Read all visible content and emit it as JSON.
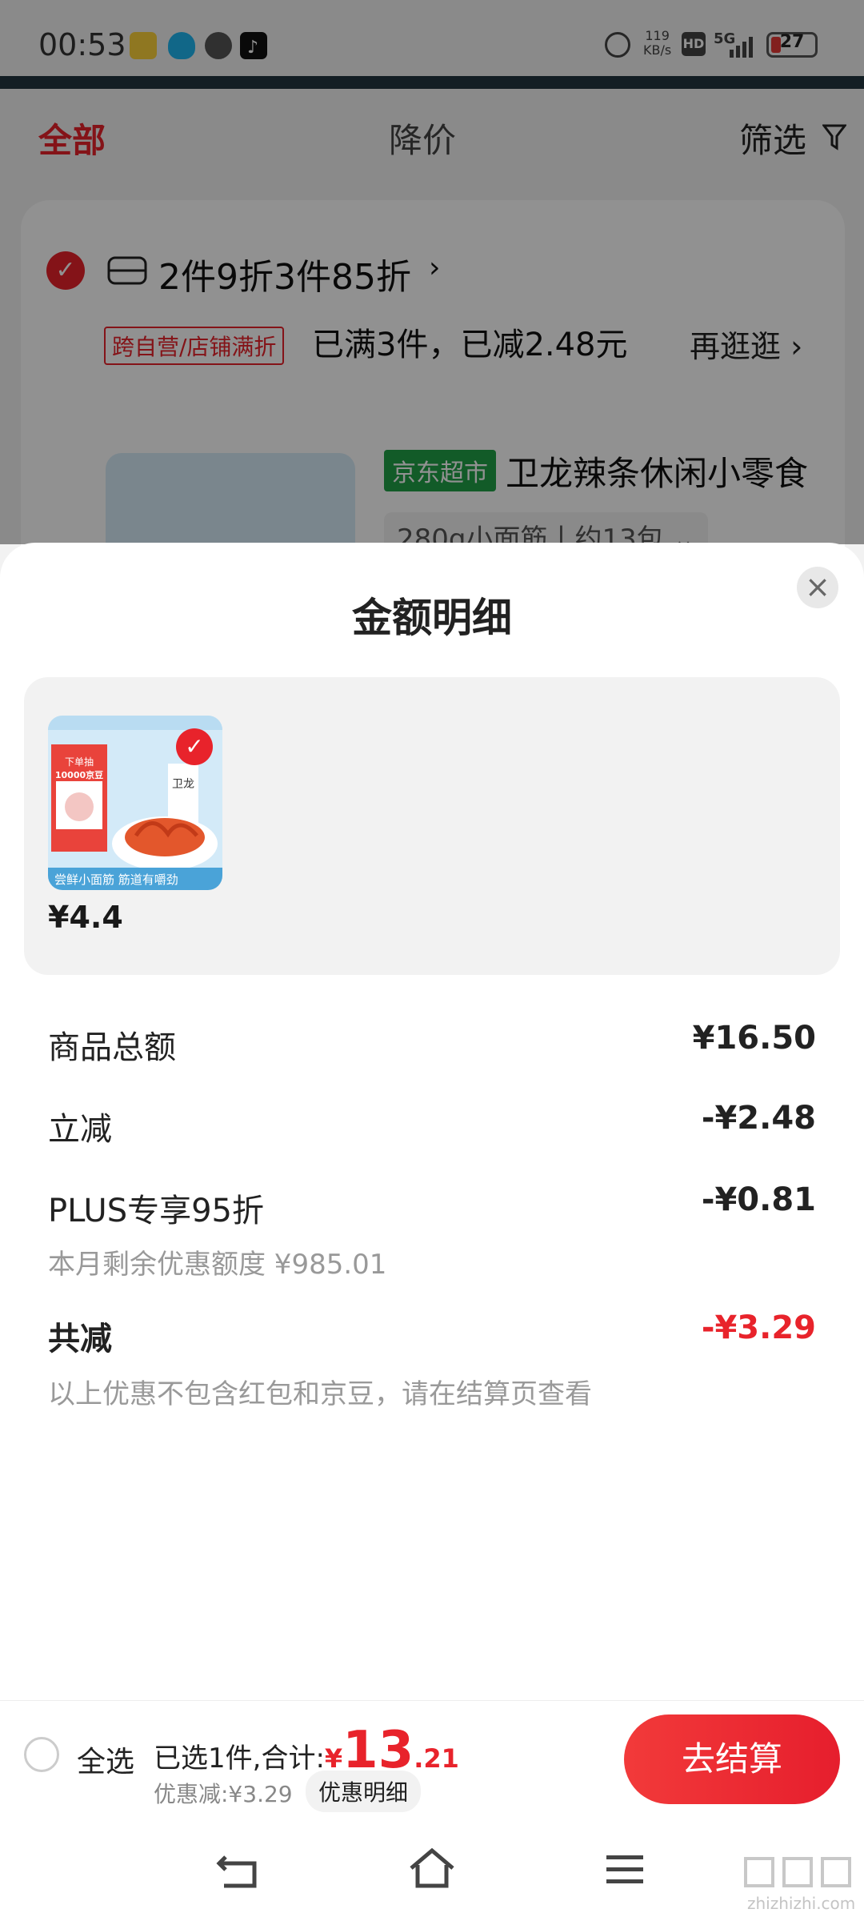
{
  "status_bar": {
    "time": "00:53",
    "net_speed_top": "119",
    "net_speed_unit": "KB/s",
    "hd": "HD",
    "signal": "5G",
    "battery": "27"
  },
  "top_tabs": {
    "all": "全部",
    "price_drop": "降价",
    "filter": "筛选"
  },
  "background_card": {
    "promo_title": "2件9折3件85折",
    "promo_tag": "跨自营/店铺满折",
    "promo_status": "已满3件，已减2.48元",
    "browse_more": "再逛逛",
    "store_tag": "京东超市",
    "product_title": "卫龙辣条休闲小零食",
    "spec": "280g小面筋丨约13包"
  },
  "sheet": {
    "title": "金额明细",
    "item": {
      "price": "¥4.4",
      "thumb_top_text": "下单抽",
      "thumb_coupon": "10000京豆",
      "thumb_brand": "卫龙",
      "thumb_bottom_text": "尝鲜小面筋 筋道有嚼劲"
    },
    "rows": [
      {
        "label": "商品总额",
        "value": "¥16.50"
      },
      {
        "label": "立减",
        "value": "-¥2.48"
      },
      {
        "label": "PLUS专享95折",
        "value": "-¥0.81",
        "sub": "本月剩余优惠额度 ¥985.01"
      },
      {
        "label": "共减",
        "value": "-¥3.29",
        "sub": "以上优惠不包含红包和京豆，请在结算页查看"
      }
    ]
  },
  "bottom_bar": {
    "select_all": "全选",
    "selected_text": "已选1件,合计:",
    "currency": "¥",
    "total_int": "13",
    "total_dec": ".21",
    "discount_text": "优惠减:¥3.29",
    "discount_detail": "优惠明细",
    "checkout": "去结算"
  },
  "watermark": {
    "text": "zhizhizhi.com"
  },
  "colors": {
    "accent": "#e8232b",
    "store_green": "#21a047"
  }
}
